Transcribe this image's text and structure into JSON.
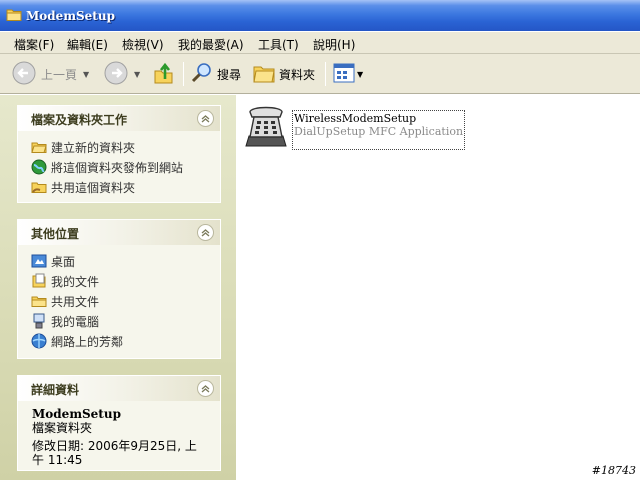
{
  "window": {
    "title": "ModemSetup"
  },
  "menu": {
    "items": [
      "檔案(F)",
      "編輯(E)",
      "檢視(V)",
      "我的最愛(A)",
      "工具(T)",
      "說明(H)"
    ]
  },
  "toolbar": {
    "back_label": "上一頁",
    "search_label": "搜尋",
    "folders_label": "資料夾"
  },
  "panels": {
    "tasks": {
      "title": "檔案及資料夾工作",
      "items": [
        "建立新的資料夾",
        "將這個資料夾發佈到網站",
        "共用這個資料夾"
      ]
    },
    "other": {
      "title": "其他位置",
      "items": [
        "桌面",
        "我的文件",
        "共用文件",
        "我的電腦",
        "網路上的芳鄰"
      ]
    },
    "details": {
      "title": "詳細資料",
      "name": "ModemSetup",
      "type": "檔案資料夾",
      "modified": "修改日期: 2006年9月25日, 上午 11:45"
    }
  },
  "files": [
    {
      "name": "WirelessModemSetup",
      "description": "DialUpSetup MFC Application",
      "icon": "telephone-icon"
    }
  ],
  "watermark": "#18743",
  "colors": {
    "titlebar": "#2a63d4",
    "chrome": "#ece9d8",
    "panel": "#f6f6ec"
  }
}
